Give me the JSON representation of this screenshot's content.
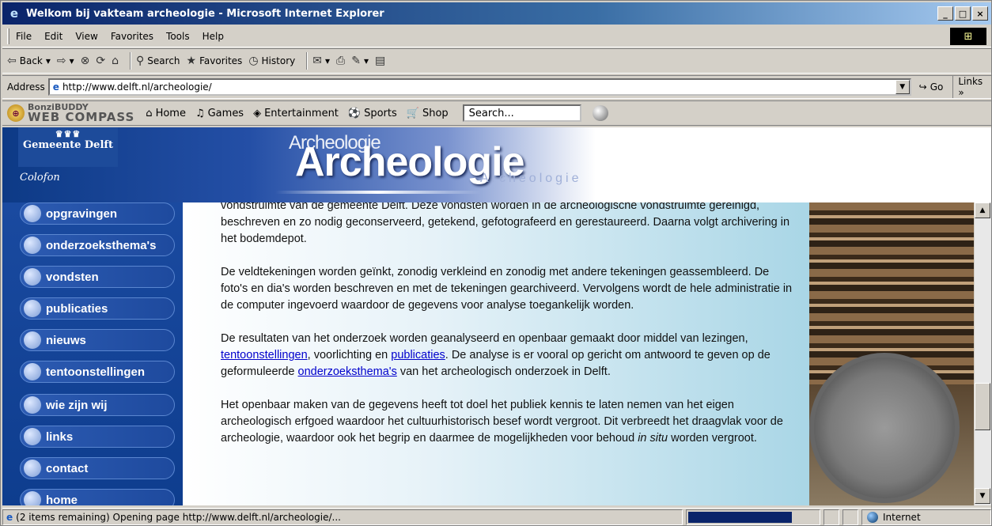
{
  "window": {
    "title": "Welkom bij vakteam archeologie - Microsoft Internet Explorer",
    "controls": [
      "_",
      "□",
      "×"
    ]
  },
  "menu": [
    "File",
    "Edit",
    "View",
    "Favorites",
    "Tools",
    "Help"
  ],
  "toolbar": {
    "back": "Back",
    "search": "Search",
    "favorites": "Favorites",
    "history": "History"
  },
  "address": {
    "label": "Address",
    "url": "http://www.delft.nl/archeologie/",
    "go": "Go",
    "links": "Links"
  },
  "bonzi": {
    "brand_top": "BonziBUDDY",
    "brand_bottom": "WEB COMPASS",
    "items": [
      "Home",
      "Games",
      "Entertainment",
      "Sports",
      "Shop"
    ],
    "search_value": "Search..."
  },
  "header": {
    "org": "Gemeente Delft",
    "colofon": "Colofon",
    "title_small": "Archeologie",
    "title_big": "Archeologie",
    "title_ghost": "Archeologie"
  },
  "nav": [
    "opgravingen",
    "onderzoeksthema's",
    "vondsten",
    "publicaties",
    "nieuws",
    "tentoonstellingen",
    "wie zijn wij",
    "links",
    "contact",
    "home"
  ],
  "article": {
    "p0": "vondstruimte van de gemeente Delft. Deze vondsten worden in de archeologische vondstruimte gereinigd, beschreven en zo nodig geconserveerd, getekend, gefotografeerd en gerestaureerd. Daarna volgt archivering in het bodemdepot.",
    "p1": "De veldtekeningen worden geïnkt, zonodig verkleind en zonodig met andere tekeningen geassembleerd. De foto's en dia's worden beschreven en met de tekeningen gearchiveerd. Vervolgens wordt de hele administratie in de computer ingevoerd waardoor de gegevens voor analyse toegankelijk worden.",
    "p2_a": "De resultaten van het onderzoek worden geanalyseerd en openbaar gemaakt door middel van lezingen,",
    "p2_link1": " tentoonstellingen",
    "p2_b": ", voorlichting en ",
    "p2_link2": "publicaties",
    "p2_c": ". De analyse is er vooral op gericht om antwoord te geven op de geformuleerde ",
    "p2_link3": "onderzoeksthema's",
    "p2_d": " van het archeologisch onderzoek in Delft.",
    "p3_a": "Het openbaar maken van de gegevens heeft tot doel het publiek kennis te laten nemen van het eigen archeologisch erfgoed waardoor het cultuurhistorisch besef wordt vergroot. Dit verbreedt het draagvlak voor de archeologie, waardoor ook het begrip en daarmee de mogelijkheden voor behoud ",
    "p3_em": "in situ",
    "p3_b": " worden vergroot."
  },
  "status": {
    "text": "(2 items remaining) Opening page http://www.delft.nl/archeologie/...",
    "progress": 0.8,
    "zone": "Internet"
  }
}
